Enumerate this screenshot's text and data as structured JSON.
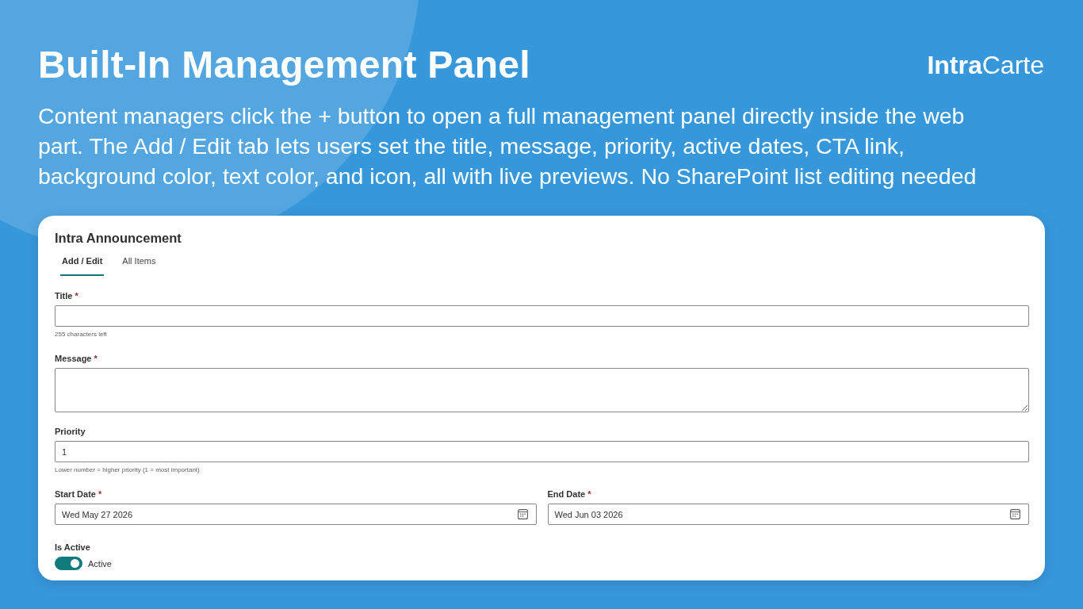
{
  "header": {
    "title": "Built-In Management Panel",
    "logo": "**Intra**Carte",
    "description": "Content managers click the + button to open a full management panel directly inside the web part. The Add / Edit tab lets users set the title, message, priority, active dates, CTA link, background color, text color, and icon, all with live previews. No SharePoint list editing needed"
  },
  "panel": {
    "title": "Intra Announcement",
    "tabs": [
      {
        "label": "Add / Edit",
        "selected": true
      },
      {
        "label": "All Items",
        "selected": false
      }
    ],
    "fields": [
      {
        "kind": "text",
        "label": "Title",
        "required_mark": "*",
        "hint": "255 characters left"
      },
      {
        "kind": "textarea",
        "label": "Message",
        "required_mark": "*"
      },
      {
        "kind": "text",
        "label": "Priority",
        "value": "1",
        "hint": "Lower number = higher priority (1 = most important)"
      },
      {
        "kind": "date",
        "label": "Start Date",
        "required_mark": "*",
        "value": "Wed May 27 2026"
      },
      {
        "kind": "date",
        "label": "End Date",
        "required_mark": "*",
        "value": "Wed Jun 03 2026"
      },
      {
        "kind": "toggle",
        "label": "Is Active",
        "on": true,
        "state_text": "Active"
      }
    ]
  }
}
